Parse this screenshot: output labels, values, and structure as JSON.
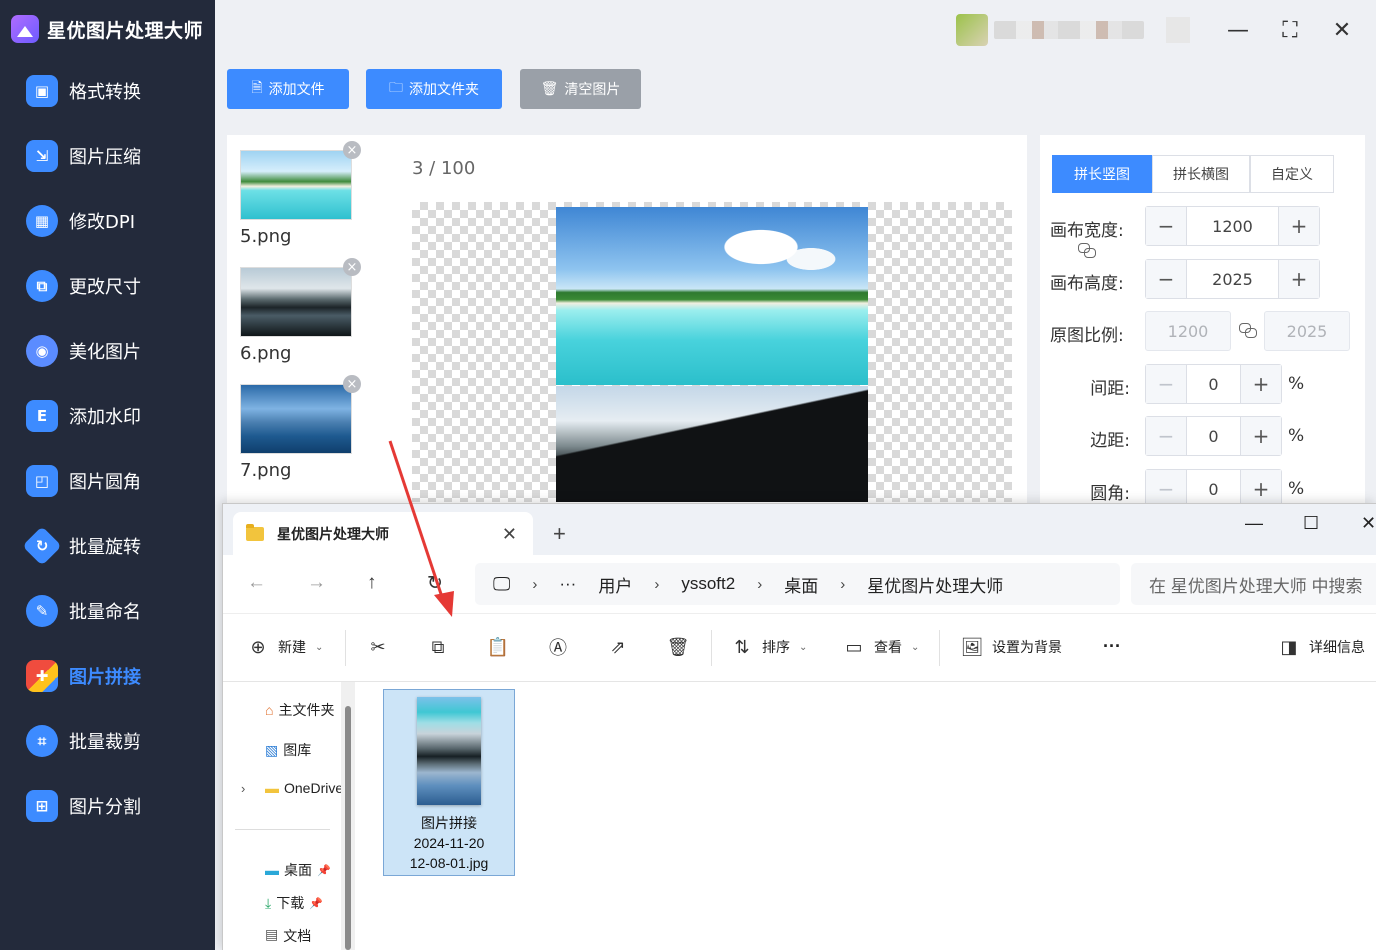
{
  "app": {
    "title": "星优图片处理大师",
    "window_controls": {
      "minimize": "—",
      "maximize": "⛶",
      "close": "✕"
    }
  },
  "sidebar": {
    "items": [
      {
        "label": "格式转换",
        "icon": "format-convert-icon",
        "color": "#3d8bff"
      },
      {
        "label": "图片压缩",
        "icon": "compress-icon",
        "color": "#3d8bff"
      },
      {
        "label": "修改DPI",
        "icon": "dpi-icon",
        "color": "#3d8bff"
      },
      {
        "label": "更改尺寸",
        "icon": "resize-icon",
        "color": "#3d8bff"
      },
      {
        "label": "美化图片",
        "icon": "beautify-icon",
        "color": "#5b8cff"
      },
      {
        "label": "添加水印",
        "icon": "watermark-icon",
        "color": "#3d8bff"
      },
      {
        "label": "图片圆角",
        "icon": "round-corner-icon",
        "color": "#3d8bff"
      },
      {
        "label": "批量旋转",
        "icon": "rotate-icon",
        "color": "#3d8bff"
      },
      {
        "label": "批量命名",
        "icon": "rename-icon",
        "color": "#3d8bff"
      },
      {
        "label": "图片拼接",
        "icon": "puzzle-icon",
        "color": "#f04c3e",
        "active": true
      },
      {
        "label": "批量裁剪",
        "icon": "crop-icon",
        "color": "#3d8bff"
      },
      {
        "label": "图片分割",
        "icon": "split-icon",
        "color": "#3d8bff"
      }
    ]
  },
  "toolbar": {
    "add_file": "添加文件",
    "add_folder": "添加文件夹",
    "clear_images": "清空图片"
  },
  "thumbnails": [
    {
      "name": "5.png",
      "close": "×"
    },
    {
      "name": "6.png",
      "close": "×"
    },
    {
      "name": "7.png",
      "close": "×"
    }
  ],
  "preview": {
    "current": "3",
    "separator": " / ",
    "total": "100"
  },
  "settings": {
    "modes": [
      "拼长竖图",
      "拼长横图",
      "自定义"
    ],
    "active_mode": 0,
    "canvas_width_label": "画布宽度:",
    "canvas_width": "1200",
    "canvas_height_label": "画布高度:",
    "canvas_height": "2025",
    "ratio_label": "原图比例:",
    "ratio_width": "1200",
    "ratio_height": "2025",
    "gap_label": "间距:",
    "gap": "0",
    "margin_label": "边距:",
    "margin": "0",
    "radius_label": "圆角:",
    "radius": "0",
    "minus": "−",
    "plus": "+",
    "percent": "%"
  },
  "explorer": {
    "tab_title": "星优图片处理大师",
    "tab_close": "✕",
    "new_tab": "+",
    "controls": {
      "minimize": "—",
      "maximize": "☐",
      "close": "✕"
    },
    "nav": {
      "back": "←",
      "forward": "→",
      "up": "↑",
      "refresh": "↻"
    },
    "breadcrumb": {
      "more": "···",
      "parts": [
        "用户",
        "yssoft2",
        "桌面",
        "星优图片处理大师"
      ],
      "sep": "›"
    },
    "search_placeholder": "在 星优图片处理大师 中搜索",
    "toolbar": {
      "new": "新建",
      "sort": "排序",
      "view": "查看",
      "set_background": "设置为背景",
      "more": "···",
      "details": "详细信息"
    },
    "tree": [
      "主文件夹",
      "图库",
      "OneDrive",
      "桌面",
      "下载",
      "文档"
    ],
    "file": {
      "name_line1": "图片拼接",
      "name_line2": "2024-11-20",
      "name_line3": "12-08-01.jpg"
    }
  },
  "colors": {
    "accent": "#3d8bff",
    "sidebar_bg": "#232a3b",
    "annotation": "#e53935"
  }
}
